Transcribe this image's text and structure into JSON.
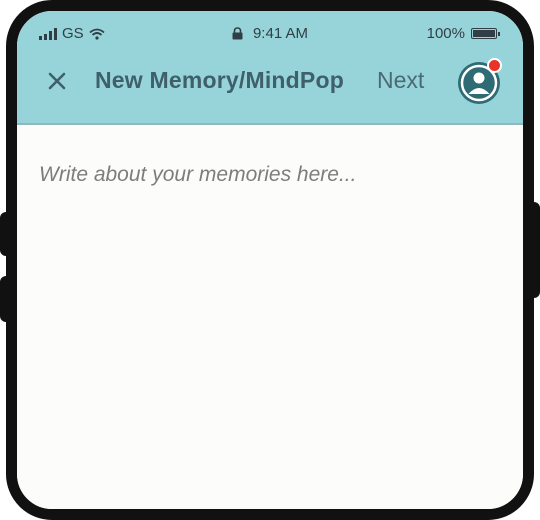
{
  "status_bar": {
    "carrier": "GS",
    "time": "9:41 AM",
    "battery": "100%",
    "icons": [
      "signal-icon",
      "wifi-icon",
      "lock-icon",
      "battery-icon"
    ]
  },
  "nav": {
    "close_icon": "close-icon",
    "title": "New Memory/MindPop",
    "next_label": "Next",
    "avatar_icon": "user-avatar-icon",
    "notification": true
  },
  "editor": {
    "placeholder": "Write about your memories here..."
  },
  "colors": {
    "header_bg": "#97d4da",
    "title_text": "#3f5f6a",
    "avatar": "#2f6b75",
    "notification": "#e8332a",
    "placeholder_text": "#7d7d7d"
  }
}
